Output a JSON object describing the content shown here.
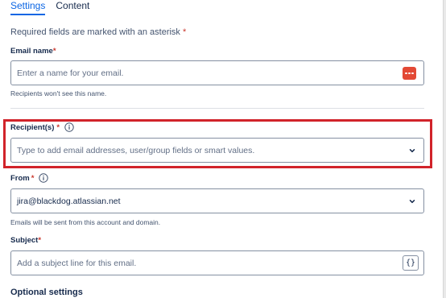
{
  "tabs": [
    {
      "label": "Settings",
      "active": true
    },
    {
      "label": "Content",
      "active": false
    }
  ],
  "required_note": "Required fields are marked with an asterisk",
  "required_star": "*",
  "email_name": {
    "label": "Email name",
    "placeholder": "Enter a name for your email.",
    "help": "Recipients won't see this name.",
    "action_icon": "more-dots-icon"
  },
  "recipients": {
    "label": "Recipient(s)",
    "placeholder": "Type to add email addresses, user/group fields or smart values.",
    "info_icon": "info-icon",
    "dropdown_icon": "chevron-down-icon",
    "highlight_color": "#d1232a"
  },
  "from": {
    "label": "From",
    "value": "jira@blackdog.atlassian.net",
    "help": "Emails will be sent from this account and domain.",
    "info_icon": "info-icon",
    "dropdown_icon": "chevron-down-icon"
  },
  "subject": {
    "label": "Subject",
    "placeholder": "Add a subject line for this email.",
    "action_label": "{}",
    "action_icon": "smart-value-braces-icon"
  },
  "optional_settings": "Optional settings",
  "colors": {
    "accent": "#0c66e4",
    "required": "#c9372c",
    "text": "#172b4d",
    "border": "#8590a2"
  }
}
